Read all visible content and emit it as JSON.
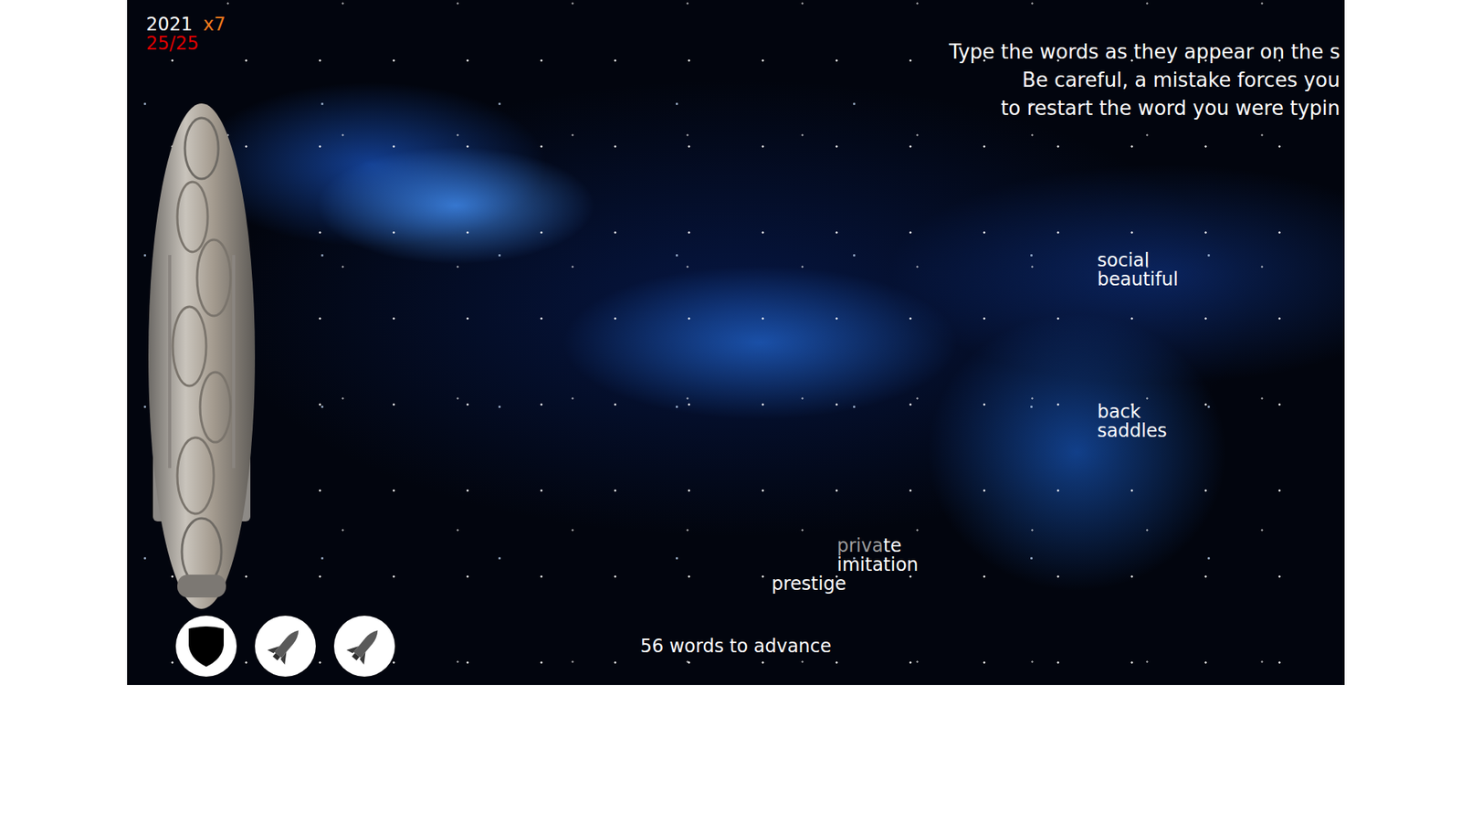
{
  "hud": {
    "score": "2021",
    "multiplier": "x7",
    "health": "25/25"
  },
  "instructions": [
    "Type the words as they appear on the s",
    "Be careful, a mistake forces you",
    "to restart the word you were typin"
  ],
  "targets": [
    {
      "words": [
        {
          "parts": [
            {
              "text": "social",
              "typed": false
            }
          ]
        },
        {
          "parts": [
            {
              "text": "beautiful",
              "typed": false
            }
          ]
        }
      ]
    },
    {
      "words": [
        {
          "parts": [
            {
              "text": "back",
              "typed": false
            }
          ]
        },
        {
          "parts": [
            {
              "text": "saddles",
              "typed": false
            }
          ]
        }
      ]
    },
    {
      "words": [
        {
          "parts": [
            {
              "text": "priva",
              "typed": true
            },
            {
              "text": "te",
              "typed": false
            }
          ]
        },
        {
          "parts": [
            {
              "text": "imitation",
              "typed": false
            }
          ]
        }
      ]
    },
    {
      "words": [
        {
          "parts": [
            {
              "text": "prestige",
              "typed": false
            }
          ]
        }
      ]
    }
  ],
  "powerups": [
    {
      "kind": "shield"
    },
    {
      "kind": "missile"
    },
    {
      "kind": "missile"
    }
  ],
  "status": {
    "remaining": "56 words to advance"
  }
}
